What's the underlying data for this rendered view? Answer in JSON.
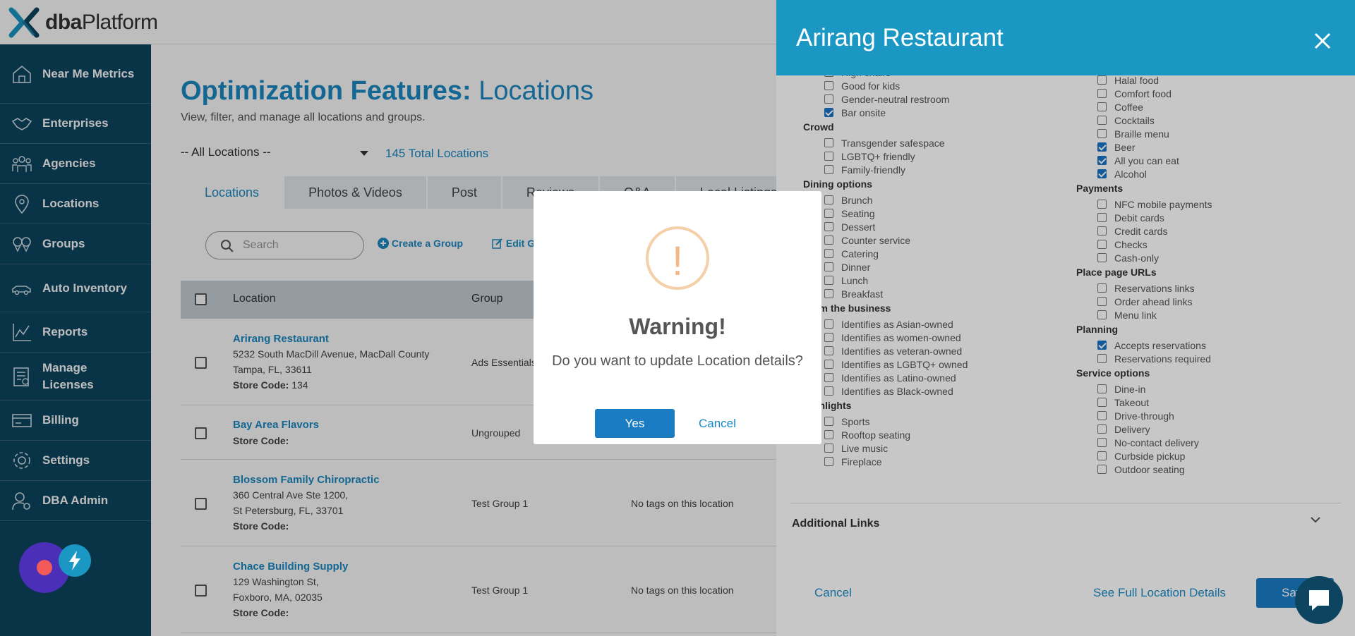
{
  "app": {
    "logo_text_bold": "dba",
    "logo_text_regular": "Platform",
    "colors": {
      "accent": "#1a8bc6",
      "sidebar": "#0d4560",
      "panel_header": "#1b97c4",
      "warning": "#f4b786"
    }
  },
  "sidebar": {
    "items": [
      {
        "label": "Near Me Metrics",
        "icon": "home-icon"
      },
      {
        "label": "Enterprises",
        "icon": "handshake-icon"
      },
      {
        "label": "Agencies",
        "icon": "team-icon"
      },
      {
        "label": "Locations",
        "icon": "map-pin-icon"
      },
      {
        "label": "Groups",
        "icon": "group-pins-icon"
      },
      {
        "label": "Auto Inventory",
        "icon": "car-icon"
      },
      {
        "label": "Reports",
        "icon": "chart-icon"
      },
      {
        "label": "Manage Licenses",
        "icon": "license-icon"
      },
      {
        "label": "Billing",
        "icon": "billing-icon"
      },
      {
        "label": "Settings",
        "icon": "gear-icon"
      },
      {
        "label": "DBA Admin",
        "icon": "admin-icon"
      }
    ]
  },
  "main": {
    "title_bold": "Optimization Features:",
    "title_thin": "Locations",
    "subtitle": "View, filter, and manage all locations and groups.",
    "location_select": "-- All Locations --",
    "total_locations": "145 Total Locations",
    "tabs": [
      "Locations",
      "Photos & Videos",
      "Post",
      "Reviews",
      "Q&A",
      "Local Listings"
    ],
    "search_placeholder": "Search",
    "create_group": "Create a Group",
    "edit_group": "Edit Group",
    "columns": [
      "Location",
      "Group"
    ],
    "rows": [
      {
        "name": "Arirang Restaurant",
        "address1": "5232 South MacDill Avenue, MacDall County",
        "address2": "Tampa, FL, 33611",
        "store_label": "Store Code:",
        "store_code": "134",
        "group": "Ads Essentials",
        "tags": ""
      },
      {
        "name": "Bay Area Flavors",
        "address1": "",
        "address2": "",
        "store_label": "Store Code:",
        "store_code": "",
        "group": "Ungrouped",
        "tags": ""
      },
      {
        "name": "Blossom Family Chiropractic",
        "address1": "360 Central Ave Ste 1200,",
        "address2": "St Petersburg, FL, 33701",
        "store_label": "Store Code:",
        "store_code": "",
        "group": "Test Group 1",
        "tags": "No tags on this location"
      },
      {
        "name": "Chace Building Supply",
        "address1": "129 Washington St,",
        "address2": "Foxboro, MA, 02035",
        "store_label": "Store Code:",
        "store_code": "",
        "group": "Test Group 1",
        "tags": "No tags on this location"
      }
    ]
  },
  "panel": {
    "title": "Arirang Restaurant",
    "left_column": [
      {
        "type": "item",
        "label": "High chairs",
        "checked": false
      },
      {
        "type": "item",
        "label": "Good for kids",
        "checked": false
      },
      {
        "type": "item",
        "label": "Gender-neutral restroom",
        "checked": false
      },
      {
        "type": "item",
        "label": "Bar onsite",
        "checked": true
      },
      {
        "type": "cat",
        "label": "Crowd"
      },
      {
        "type": "item",
        "label": "Transgender safespace",
        "checked": false
      },
      {
        "type": "item",
        "label": "LGBTQ+ friendly",
        "checked": false
      },
      {
        "type": "item",
        "label": "Family-friendly",
        "checked": false
      },
      {
        "type": "cat",
        "label": "Dining options"
      },
      {
        "type": "item",
        "label": "Brunch",
        "checked": false
      },
      {
        "type": "item",
        "label": "Seating",
        "checked": false
      },
      {
        "type": "item",
        "label": "Dessert",
        "checked": false
      },
      {
        "type": "item",
        "label": "Counter service",
        "checked": false
      },
      {
        "type": "item",
        "label": "Catering",
        "checked": false
      },
      {
        "type": "item",
        "label": "Dinner",
        "checked": false
      },
      {
        "type": "item",
        "label": "Lunch",
        "checked": false
      },
      {
        "type": "item",
        "label": "Breakfast",
        "checked": false
      },
      {
        "type": "cat",
        "label": "From the business"
      },
      {
        "type": "item",
        "label": "Identifies as Asian-owned",
        "checked": false
      },
      {
        "type": "item",
        "label": "Identifies as women-owned",
        "checked": false
      },
      {
        "type": "item",
        "label": "Identifies as veteran-owned",
        "checked": false
      },
      {
        "type": "item",
        "label": "Identifies as LGBTQ+ owned",
        "checked": false
      },
      {
        "type": "item",
        "label": "Identifies as Latino-owned",
        "checked": false
      },
      {
        "type": "item",
        "label": "Identifies as Black-owned",
        "checked": false
      },
      {
        "type": "cat",
        "label": "Highlights"
      },
      {
        "type": "item",
        "label": "Sports",
        "checked": false
      },
      {
        "type": "item",
        "label": "Rooftop seating",
        "checked": false
      },
      {
        "type": "item",
        "label": "Live music",
        "checked": false
      },
      {
        "type": "item",
        "label": "Fireplace",
        "checked": false
      }
    ],
    "right_column": [
      {
        "type": "item",
        "label": "Halal food",
        "checked": false
      },
      {
        "type": "item",
        "label": "Comfort food",
        "checked": false
      },
      {
        "type": "item",
        "label": "Coffee",
        "checked": false
      },
      {
        "type": "item",
        "label": "Cocktails",
        "checked": false
      },
      {
        "type": "item",
        "label": "Braille menu",
        "checked": false
      },
      {
        "type": "item",
        "label": "Beer",
        "checked": true
      },
      {
        "type": "item",
        "label": "All you can eat",
        "checked": true
      },
      {
        "type": "item",
        "label": "Alcohol",
        "checked": true
      },
      {
        "type": "cat",
        "label": "Payments"
      },
      {
        "type": "item",
        "label": "NFC mobile payments",
        "checked": false
      },
      {
        "type": "item",
        "label": "Debit cards",
        "checked": false
      },
      {
        "type": "item",
        "label": "Credit cards",
        "checked": false
      },
      {
        "type": "item",
        "label": "Checks",
        "checked": false
      },
      {
        "type": "item",
        "label": "Cash-only",
        "checked": false
      },
      {
        "type": "cat",
        "label": "Place page URLs"
      },
      {
        "type": "item",
        "label": "Reservations links",
        "checked": false
      },
      {
        "type": "item",
        "label": "Order ahead links",
        "checked": false
      },
      {
        "type": "item",
        "label": "Menu link",
        "checked": false
      },
      {
        "type": "cat",
        "label": "Planning"
      },
      {
        "type": "item",
        "label": "Accepts reservations",
        "checked": true
      },
      {
        "type": "item",
        "label": "Reservations required",
        "checked": false
      },
      {
        "type": "cat",
        "label": "Service options"
      },
      {
        "type": "item",
        "label": "Dine-in",
        "checked": false
      },
      {
        "type": "item",
        "label": "Takeout",
        "checked": false
      },
      {
        "type": "item",
        "label": "Drive-through",
        "checked": false
      },
      {
        "type": "item",
        "label": "Delivery",
        "checked": false
      },
      {
        "type": "item",
        "label": "No-contact delivery",
        "checked": false
      },
      {
        "type": "item",
        "label": "Curbside pickup",
        "checked": false
      },
      {
        "type": "item",
        "label": "Outdoor seating",
        "checked": false
      }
    ],
    "additional_links": "Additional Links",
    "cancel": "Cancel",
    "see_full": "See Full Location Details",
    "save": "Save"
  },
  "modal": {
    "icon_glyph": "!",
    "title": "Warning!",
    "message": "Do you want to update Location details?",
    "yes": "Yes",
    "cancel": "Cancel"
  }
}
